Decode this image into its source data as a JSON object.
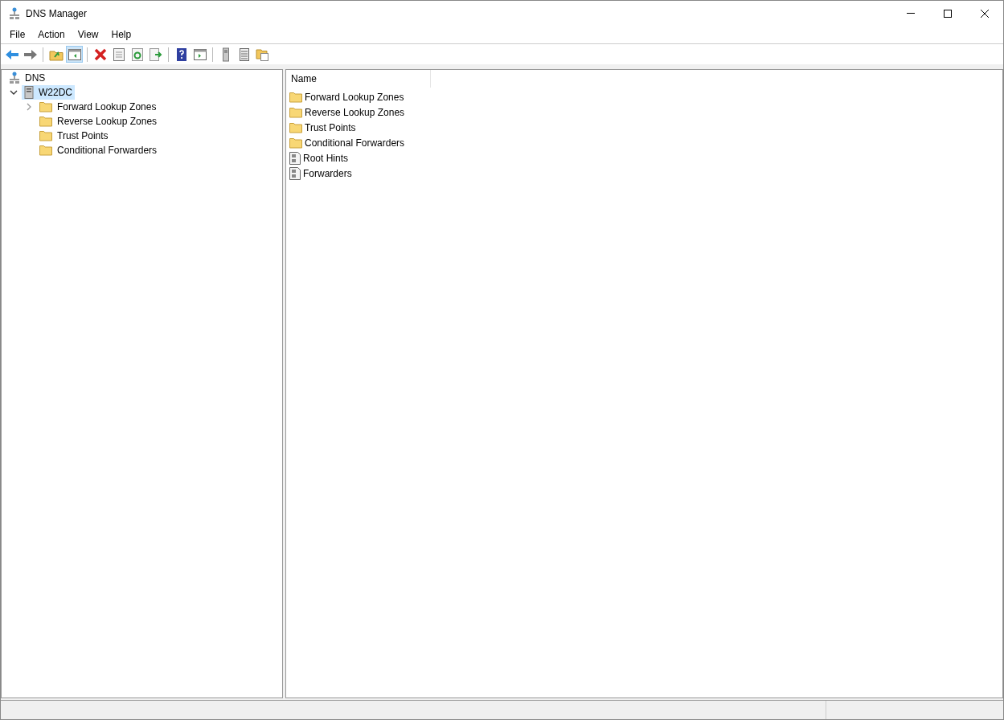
{
  "window": {
    "title": "DNS Manager"
  },
  "menu": [
    "File",
    "Action",
    "View",
    "Help"
  ],
  "toolbar": [
    [
      {
        "kind": "back",
        "pressed": false
      },
      {
        "kind": "forward",
        "pressed": false
      }
    ],
    [
      {
        "kind": "up",
        "pressed": false
      },
      {
        "kind": "tree",
        "pressed": true
      }
    ],
    [
      {
        "kind": "delete",
        "pressed": false
      },
      {
        "kind": "properties",
        "pressed": false
      },
      {
        "kind": "refresh",
        "pressed": false
      },
      {
        "kind": "export",
        "pressed": false
      }
    ],
    [
      {
        "kind": "help",
        "pressed": false
      },
      {
        "kind": "action",
        "pressed": false
      }
    ],
    [
      {
        "kind": "server",
        "pressed": false
      },
      {
        "kind": "list",
        "pressed": false
      },
      {
        "kind": "folders",
        "pressed": false
      }
    ]
  ],
  "tree": [
    {
      "label": "DNS",
      "kind": "dns",
      "selected": false,
      "children": [
        {
          "label": "W22DC",
          "kind": "server",
          "expanded": true,
          "selected": true,
          "children": [
            {
              "label": "Forward Lookup Zones",
              "kind": "folder",
              "expanded": false,
              "selected": false
            },
            {
              "label": "Reverse Lookup Zones",
              "kind": "folder",
              "selected": false
            },
            {
              "label": "Trust Points",
              "kind": "folder",
              "selected": false
            },
            {
              "label": "Conditional Forwarders",
              "kind": "folder",
              "selected": false
            }
          ]
        }
      ]
    }
  ],
  "list": {
    "columns": [
      "Name"
    ],
    "rows": [
      {
        "name": "Forward Lookup Zones",
        "kind": "folder"
      },
      {
        "name": "Reverse Lookup Zones",
        "kind": "folder"
      },
      {
        "name": "Trust Points",
        "kind": "folder"
      },
      {
        "name": "Conditional Forwarders",
        "kind": "folder"
      },
      {
        "name": "Root Hints",
        "kind": "records"
      },
      {
        "name": "Forwarders",
        "kind": "records"
      }
    ]
  }
}
